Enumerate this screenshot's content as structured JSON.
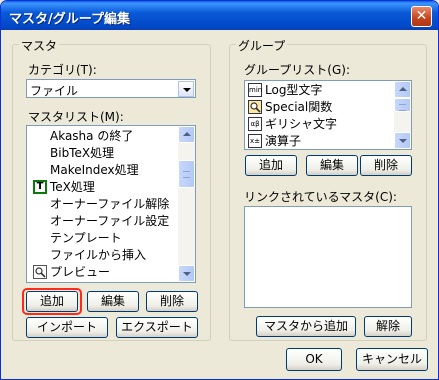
{
  "window": {
    "title": "マスタ/グループ編集",
    "close_glyph": "✕"
  },
  "master": {
    "legend": "マスタ",
    "category_label": "カテゴリ(T):",
    "category_value": "ファイル",
    "list_label": "マスタリスト(M):",
    "items": [
      {
        "label": "Akasha の終了",
        "icon": "none"
      },
      {
        "label": "BibTeX処理",
        "icon": "none"
      },
      {
        "label": "MakeIndex処理",
        "icon": "none"
      },
      {
        "label": "TeX処理",
        "icon": "tex-icon",
        "icon_text": "T"
      },
      {
        "label": "オーナーファイル解除",
        "icon": "none"
      },
      {
        "label": "オーナーファイル設定",
        "icon": "none"
      },
      {
        "label": "テンプレート",
        "icon": "none"
      },
      {
        "label": "ファイルから挿入",
        "icon": "none"
      },
      {
        "label": "プレビュー",
        "icon": "preview-icon"
      }
    ],
    "buttons": {
      "add": "追加",
      "edit": "編集",
      "delete": "削除",
      "import": "インポート",
      "export": "エクスポート"
    }
  },
  "group": {
    "legend": "グループ",
    "list_label": "グループリスト(G):",
    "items": [
      {
        "label": "Log型文字",
        "icon": "min-icon",
        "icon_text": "min"
      },
      {
        "label": "Special関数",
        "icon": "magnifier-icon",
        "icon_text": "🔍"
      },
      {
        "label": "ギリシャ文字",
        "icon": "greek-icon",
        "icon_text": "αβ"
      },
      {
        "label": "演算子",
        "icon": "operator-icon",
        "icon_text": "x±"
      }
    ],
    "buttons": {
      "add": "追加",
      "edit": "編集",
      "delete": "削除"
    },
    "linked_label": "リンクされているマスタ(C):",
    "linked_buttons": {
      "add_from_master": "マスタから追加",
      "remove": "解除"
    }
  },
  "footer": {
    "ok": "OK",
    "cancel": "キャンセル"
  },
  "colors": {
    "title_bar": "#0a5ad8",
    "dialog_bg": "#ece9d8",
    "highlight": "#ff2a1a"
  }
}
